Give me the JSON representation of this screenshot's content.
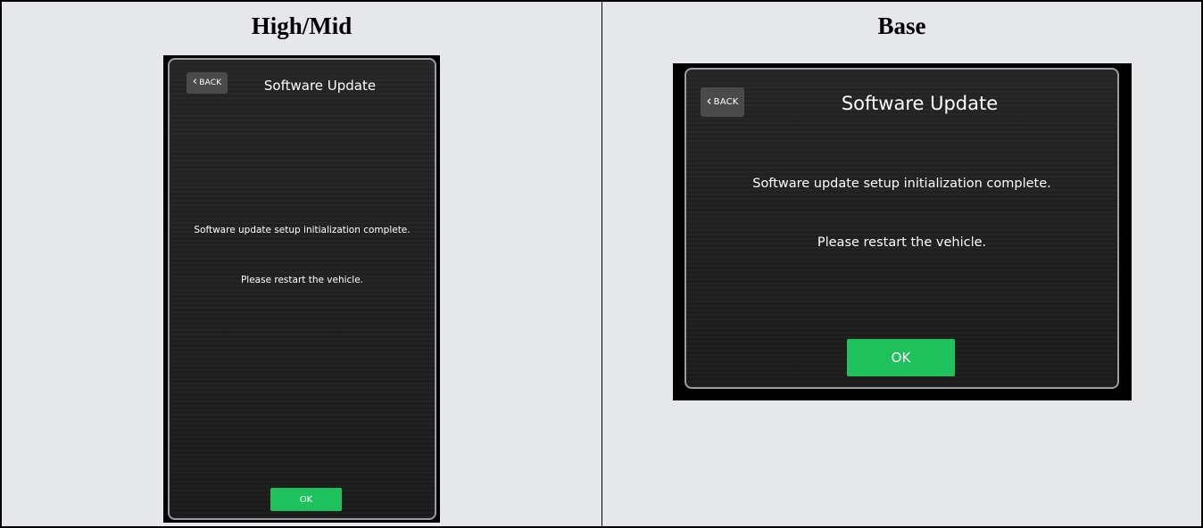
{
  "columns": [
    {
      "heading": "High/Mid",
      "screen": {
        "back_label": "BACK",
        "title": "Software Update",
        "message_line1": "Software update setup initialization complete.",
        "message_line2": "Please restart the vehicle.",
        "ok_label": "OK"
      }
    },
    {
      "heading": "Base",
      "screen": {
        "back_label": "BACK",
        "title": "Software Update",
        "message_line1": "Software update setup initialization complete.",
        "message_line2": "Please restart the vehicle.",
        "ok_label": "OK"
      }
    }
  ],
  "icons": {
    "back": "chevron-left-icon"
  },
  "colors": {
    "ok_button": "#1ec15c",
    "screen_background": "#1f1f1f",
    "back_button": "#4a4a4a",
    "cell_background": "#e6e7e9"
  }
}
